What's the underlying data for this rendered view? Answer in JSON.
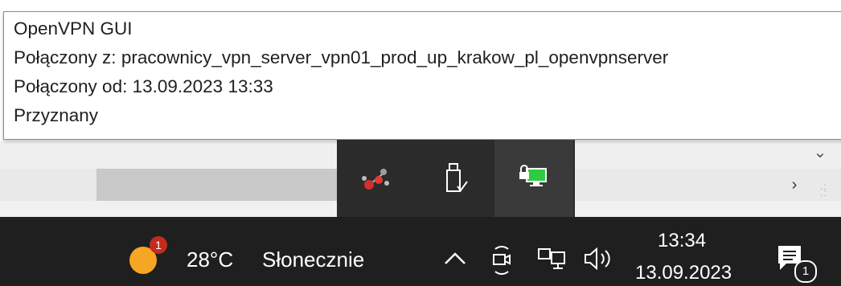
{
  "tooltip": {
    "title": "OpenVPN GUI",
    "connected_to": "Połączony z: pracownicy_vpn_server_vpn01_prod_up_krakow_pl_openvpnserver",
    "connected_since": "Połączony od: 13.09.2023 13:33",
    "status": "Przyznany"
  },
  "tray_flyout": {
    "items": [
      {
        "icon": "network-app-icon"
      },
      {
        "icon": "usb-eject-icon"
      },
      {
        "icon": "openvpn-connected-icon"
      }
    ]
  },
  "taskbar": {
    "weather": {
      "temperature": "28°C",
      "condition": "Słonecznie",
      "badge_count": "1"
    },
    "clock": {
      "time": "13:34",
      "date": "13.09.2023"
    },
    "notifications": {
      "badge_count": "1"
    }
  },
  "colors": {
    "taskbar_bg": "#1f1f1f",
    "flyout_bg": "#2b2b2b",
    "weather_sun": "#f5a623",
    "badge_red": "#c42b1c",
    "vpn_green": "#2ecc40"
  }
}
